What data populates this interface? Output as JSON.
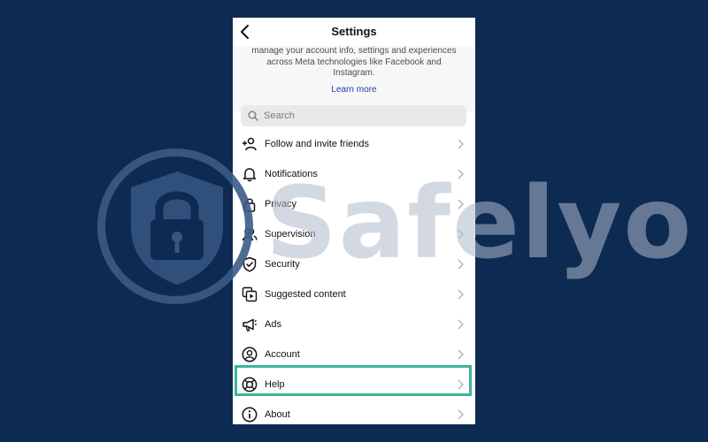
{
  "header": {
    "title": "Settings"
  },
  "info": {
    "text": "manage your account info, settings and experiences across Meta technologies like Facebook and Instagram.",
    "learn_more": "Learn more"
  },
  "search": {
    "placeholder": "Search"
  },
  "menu": [
    {
      "label": "Follow and invite friends",
      "icon": "add-person-icon"
    },
    {
      "label": "Notifications",
      "icon": "bell-icon"
    },
    {
      "label": "Privacy",
      "icon": "lock-icon"
    },
    {
      "label": "Supervision",
      "icon": "people-icon"
    },
    {
      "label": "Security",
      "icon": "shield-check-icon"
    },
    {
      "label": "Suggested content",
      "icon": "media-play-icon"
    },
    {
      "label": "Ads",
      "icon": "megaphone-icon"
    },
    {
      "label": "Account",
      "icon": "user-circle-icon"
    },
    {
      "label": "Help",
      "icon": "lifebuoy-icon",
      "highlighted": true
    },
    {
      "label": "About",
      "icon": "info-icon"
    }
  ],
  "watermark": {
    "text": "Safelyo"
  },
  "colors": {
    "background": "#0d2a52",
    "highlight": "#3db59b",
    "link": "#1d3fa8"
  }
}
